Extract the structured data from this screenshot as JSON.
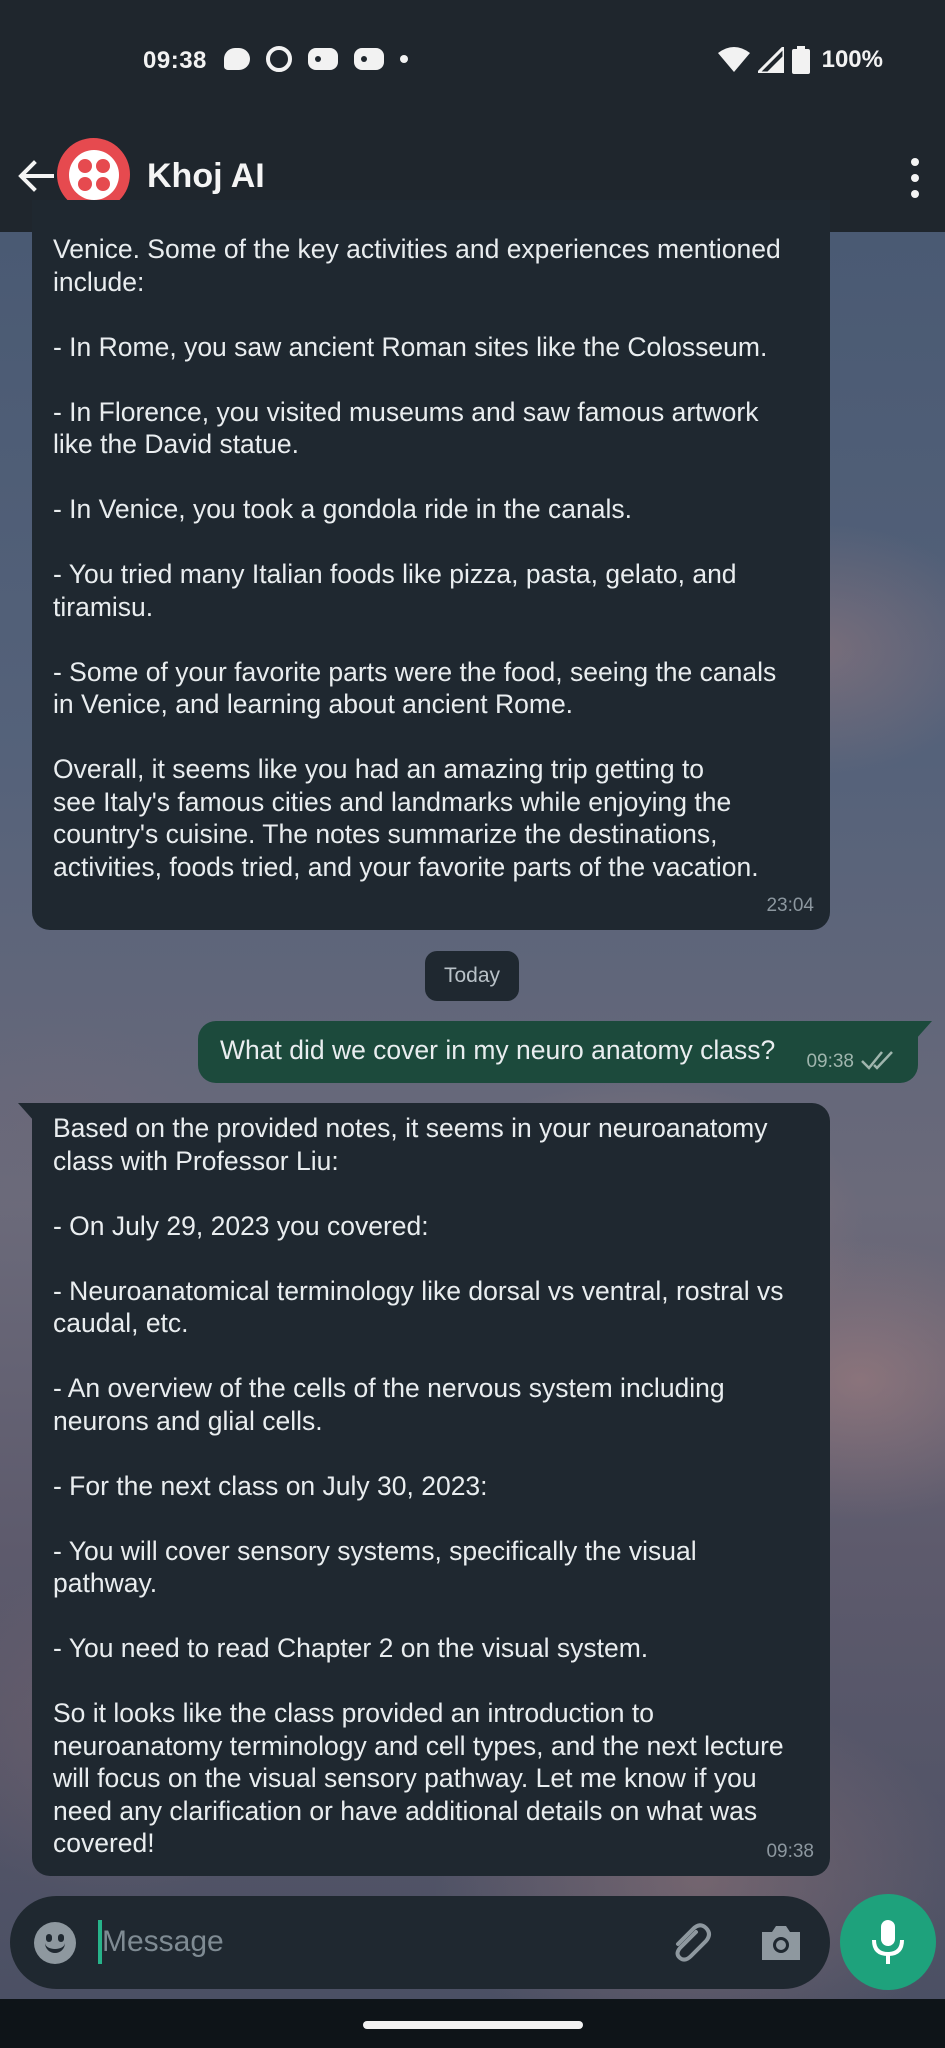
{
  "status_bar": {
    "time": "09:38",
    "battery": "100%",
    "notification_icons": [
      "chat-bubble-icon",
      "signal-app-icon",
      "discord-icon",
      "discord-icon",
      "more-dot-icon"
    ],
    "system_icons": [
      "wifi-icon",
      "cellular-icon",
      "battery-icon"
    ]
  },
  "app_bar": {
    "title": "Khoj AI",
    "avatar_icon": "twilio-logo",
    "avatar_color": "#e64a4f"
  },
  "messages": [
    {
      "direction": "incoming",
      "text": "Venice. Some of the key activities and experiences mentioned\ninclude:\n\n- In Rome, you saw ancient Roman sites like the Colosseum.\n\n- In Florence, you visited museums and saw famous artwork\nlike the David statue.\n\n- In Venice, you took a gondola ride in the canals.\n\n- You tried many Italian foods like pizza, pasta, gelato, and\ntiramisu.\n\n- Some of your favorite parts were the food, seeing the canals\nin Venice, and learning about ancient Rome.\n\nOverall, it seems like you had an amazing trip getting to\nsee Italy's famous cities and landmarks while enjoying the\ncountry's cuisine. The notes summarize the destinations,\nactivities, foods tried, and your favorite parts of the vacation.",
      "time": "23:04"
    },
    {
      "direction": "date_separator",
      "text": "Today"
    },
    {
      "direction": "outgoing",
      "text": "What did we cover in my neuro anatomy class?",
      "time": "09:38",
      "status_icon": "double-check-icon"
    },
    {
      "direction": "incoming",
      "text": "Based on the provided notes, it seems in your neuroanatomy\nclass with Professor Liu:\n\n- On July 29, 2023 you covered:\n\n- Neuroanatomical terminology like dorsal vs ventral, rostral vs\ncaudal, etc.\n\n- An overview of the cells of the nervous system including\nneurons and glial cells.\n\n- For the next class on July 30, 2023:\n\n- You will cover sensory systems, specifically the visual\npathway.\n\n- You need to read Chapter 2 on the visual system.\n\nSo it looks like the class provided an introduction to\nneuroanatomy terminology and cell types, and the next lecture\nwill focus on the visual sensory pathway. Let me know if you\nneed any clarification or have additional details on what was\ncovered!",
      "time": "09:38"
    }
  ],
  "composer": {
    "placeholder": "Message",
    "value": "",
    "emoji_icon": "emoji-icon",
    "attach_icon": "paperclip-icon",
    "camera_icon": "camera-icon",
    "mic_icon": "microphone-icon",
    "accent_color": "#1ea27c"
  },
  "colors": {
    "bar_background": "#1f262d",
    "incoming_bubble": "#1f2830",
    "outgoing_bubble": "#1c4a3c",
    "text": "#e9edef"
  }
}
